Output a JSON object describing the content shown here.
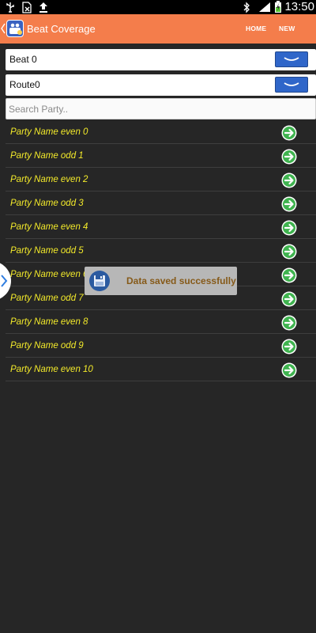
{
  "status_bar": {
    "clock": "13:50",
    "icons": [
      "usb-icon",
      "sd-card-removed-icon",
      "upload-icon",
      "bluetooth-icon",
      "signal-icon",
      "battery-charging-icon"
    ]
  },
  "action_bar": {
    "title": "Beat Coverage",
    "home_label": "HOME",
    "new_party_label": "NEW PARTY"
  },
  "filters": {
    "beat_value": "Beat 0",
    "route_value": "Route0"
  },
  "search": {
    "placeholder": "Search Party.."
  },
  "parties": [
    {
      "name": "Party Name even 0"
    },
    {
      "name": "Party Name odd 1"
    },
    {
      "name": "Party Name even 2"
    },
    {
      "name": "Party Name odd 3"
    },
    {
      "name": "Party Name even 4"
    },
    {
      "name": "Party Name odd 5"
    },
    {
      "name": "Party Name even 6"
    },
    {
      "name": "Party Name odd 7"
    },
    {
      "name": "Party Name even 8"
    },
    {
      "name": "Party Name odd 9"
    },
    {
      "name": "Party Name even 10"
    }
  ],
  "toast": {
    "message": "Data saved successfully"
  },
  "colors": {
    "action_bar": "#f47d4b",
    "dropdown_button": "#2f66c9",
    "party_text": "#f3ea2a",
    "arrow_green": "#3fb34f",
    "toast_text": "#865a19"
  }
}
